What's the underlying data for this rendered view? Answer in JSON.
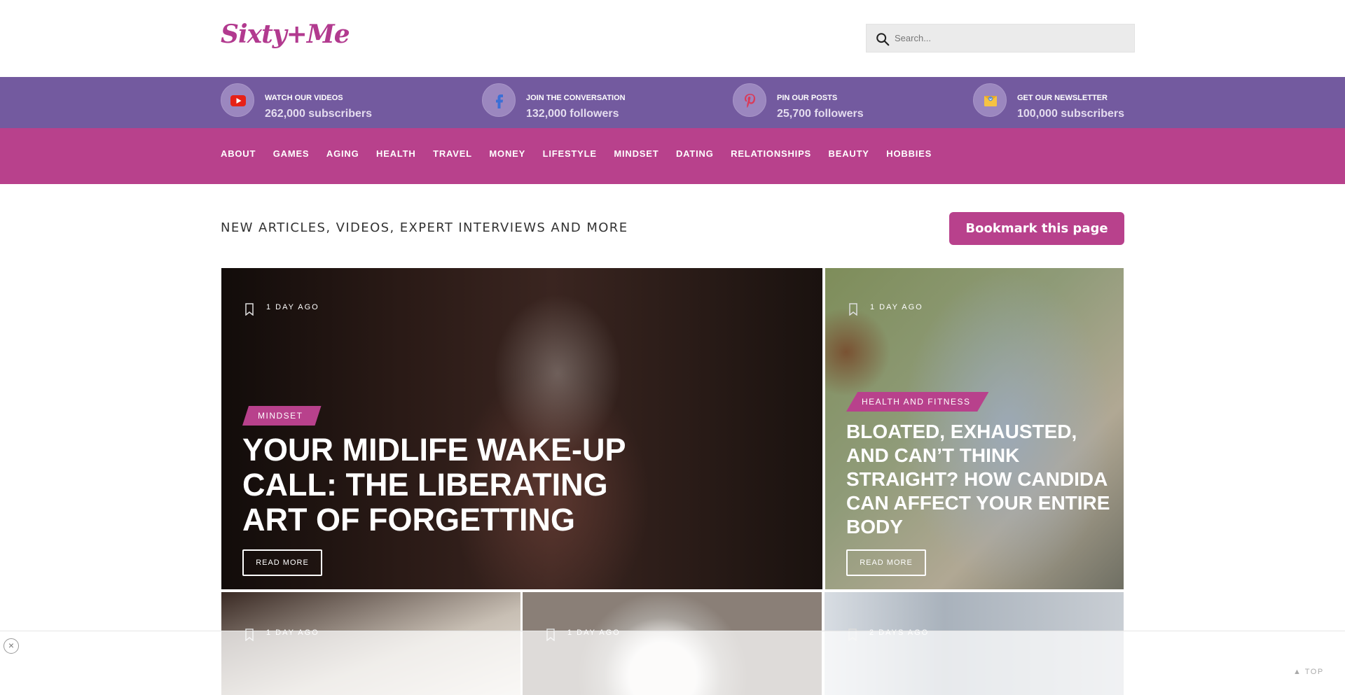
{
  "header": {
    "logo_text": "Sixty+Me",
    "search": {
      "placeholder": "Search..."
    }
  },
  "social": [
    {
      "icon": "youtube-icon",
      "label": "WATCH OUR VIDEOS",
      "count": "262,000 subscribers"
    },
    {
      "icon": "facebook-icon",
      "label": "JOIN THE CONVERSATION",
      "count": "132,000 followers"
    },
    {
      "icon": "pinterest-icon",
      "label": "PIN OUR POSTS",
      "count": "25,700 followers"
    },
    {
      "icon": "newsletter-icon",
      "label": "GET OUR NEWSLETTER",
      "count": "100,000 subscribers"
    }
  ],
  "nav": {
    "items": [
      "ABOUT",
      "GAMES",
      "AGING",
      "HEALTH",
      "TRAVEL",
      "MONEY",
      "LIFESTYLE",
      "MINDSET",
      "DATING",
      "RELATIONSHIPS",
      "BEAUTY",
      "HOBBIES"
    ]
  },
  "section": {
    "title": "NEW ARTICLES, VIDEOS, EXPERT INTERVIEWS AND MORE",
    "bookmark_label": "Bookmark this page"
  },
  "cards": [
    {
      "ago": "1 DAY AGO",
      "category": "MINDSET",
      "title": "YOUR MIDLIFE WAKE-UP CALL: THE LIBERATING ART OF FORGETTING",
      "read_more": "READ MORE"
    },
    {
      "ago": "1 DAY AGO",
      "category": "HEALTH AND FITNESS",
      "title": "BLOATED, EXHAUSTED, AND CAN’T THINK STRAIGHT? HOW CANDIDA CAN AFFECT YOUR ENTIRE BODY",
      "read_more": "READ MORE"
    },
    {
      "ago": "1 DAY AGO"
    },
    {
      "ago": "1 DAY AGO"
    },
    {
      "ago": "2 DAYS AGO"
    }
  ],
  "footer": {
    "close": "×",
    "top_label": "TOP"
  },
  "colors": {
    "brand": "#b8418c",
    "social_bar": "#735a9f"
  }
}
